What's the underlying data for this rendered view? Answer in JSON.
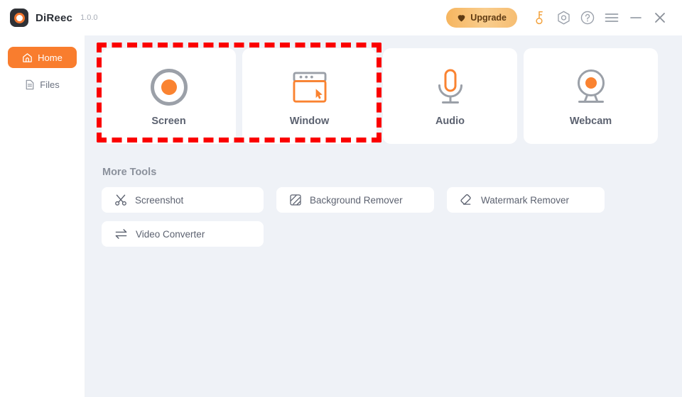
{
  "window": {
    "app_name": "DiReec",
    "version": "1.0.0",
    "logo_icon": "record-logo-icon"
  },
  "titlebar": {
    "upgrade_label": "Upgrade",
    "upgrade_icon": "heart-icon",
    "icons": [
      {
        "name": "key-icon",
        "title": "Activate"
      },
      {
        "name": "hexagon-settings-icon",
        "title": "Settings"
      },
      {
        "name": "help-circle-icon",
        "title": "Help"
      },
      {
        "name": "hamburger-menu-icon",
        "title": "Menu"
      },
      {
        "name": "minimize-icon",
        "title": "Minimize"
      },
      {
        "name": "close-icon",
        "title": "Close"
      }
    ]
  },
  "sidebar": {
    "items": [
      {
        "label": "Home",
        "icon": "home-icon",
        "active": true
      },
      {
        "label": "Files",
        "icon": "file-icon",
        "active": false
      }
    ]
  },
  "main": {
    "cards": [
      {
        "label": "Screen",
        "icon": "record-circle-icon"
      },
      {
        "label": "Window",
        "icon": "window-cursor-icon"
      },
      {
        "label": "Audio",
        "icon": "microphone-icon"
      },
      {
        "label": "Webcam",
        "icon": "webcam-icon"
      }
    ],
    "more_tools_title": "More Tools",
    "tools": [
      {
        "label": "Screenshot",
        "icon": "scissors-icon"
      },
      {
        "label": "Background Remover",
        "icon": "hatched-square-icon"
      },
      {
        "label": "Watermark Remover",
        "icon": "eraser-icon"
      },
      {
        "label": "Video Converter",
        "icon": "swap-arrows-icon"
      }
    ]
  },
  "annotation": {
    "style": "red-dashed-rectangle",
    "covers": [
      "Screen",
      "Window"
    ],
    "color": "#fb0000"
  },
  "colors": {
    "accent": "#f97d2e",
    "accent_icon": "#fa8331",
    "content_bg": "#eff2f7",
    "sidebar_bg": "#ffffff",
    "card_bg": "#ffffff",
    "icon_gray": "#9ba0a8",
    "text_dark": "#5c6270",
    "annotation_red": "#fb0000"
  }
}
